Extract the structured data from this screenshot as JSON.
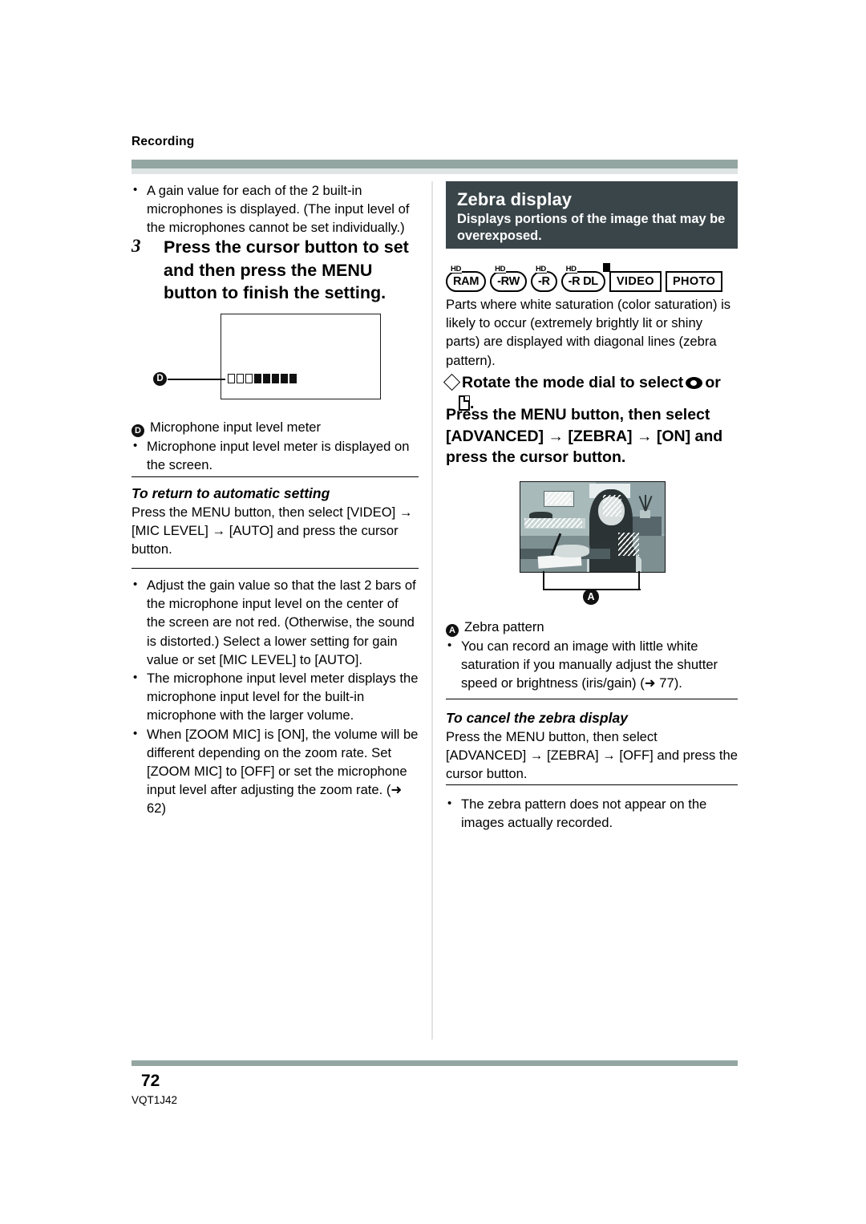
{
  "header": {
    "section": "Recording"
  },
  "footer": {
    "page_number": "72",
    "doc_code": "VQT1J42"
  },
  "left_column": {
    "intro_bullet": "A gain value for each of the 2 built-in microphones is displayed. (The input level of the microphones cannot be set individually.)",
    "step": {
      "number": "3",
      "text": "Press the cursor button to set and then press the MENU button to finish the setting."
    },
    "figure": {
      "callout_label": "D",
      "meter_cells": [
        "empty",
        "empty",
        "empty",
        "filled",
        "filled",
        "filled",
        "filled",
        "filled"
      ]
    },
    "callout_caption": "Microphone input level meter",
    "callout_bullet": "Microphone input level meter is displayed on the screen.",
    "return_auto": {
      "heading": "To return to automatic setting",
      "body": "Press the MENU button, then select [VIDEO] → [MIC LEVEL] → [AUTO] and press the cursor button."
    },
    "bullets": [
      "Adjust the gain value so that the last 2 bars of the microphone input level on the center of the screen are not red. (Otherwise, the sound is distorted.) Select a lower setting for gain value or set [MIC LEVEL] to [AUTO].",
      "The microphone input level meter displays the microphone input level for the built-in microphone with the larger volume.",
      "When [ZOOM MIC] is [ON], the volume will be different depending on the zoom rate. Set [ZOOM MIC] to [OFF] or set the microphone input level after adjusting the zoom rate. (➜ 62)"
    ]
  },
  "right_column": {
    "title_box": {
      "title": "Zebra display",
      "subtitle": "Displays portions of the image that may be overexposed."
    },
    "badges": [
      {
        "hd": "HD",
        "label": "RAM",
        "style": "disc"
      },
      {
        "hd": "HD",
        "label": "-RW",
        "style": "disc"
      },
      {
        "hd": "HD",
        "label": "-R",
        "style": "disc"
      },
      {
        "hd": "HD",
        "label": "-R DL",
        "style": "disc"
      },
      {
        "hd": "",
        "label": "VIDEO",
        "style": "tabbed"
      },
      {
        "hd": "",
        "label": "PHOTO",
        "style": "plain"
      }
    ],
    "intro_paragraph": "Parts where white saturation (color saturation) is likely to occur (extremely brightly lit or shiny parts) are displayed with diagonal lines (zebra pattern).",
    "instruction": {
      "rotate_prefix": "Rotate the mode dial to select",
      "rotate_middle": "or",
      "rotate_suffix": ".",
      "press_text": "Press the MENU button, then select [ADVANCED] → [ZEBRA] → [ON] and press the cursor button."
    },
    "illustration": {
      "callout_label": "A"
    },
    "callout_caption": "Zebra pattern",
    "callout_bullet": "You can record an image with little white saturation if you manually adjust the shutter speed or brightness (iris/gain) (➜ 77).",
    "cancel": {
      "heading": "To cancel the zebra display",
      "body": "Press the MENU button, then select [ADVANCED] → [ZEBRA] → [OFF] and press the cursor button."
    },
    "last_bullet": "The zebra pattern does not appear on the images actually recorded."
  },
  "colors": {
    "header_rule": "#94a6a2",
    "header_rule_light": "#dde4e3",
    "dark_box": "#3a4549",
    "text": "#000000"
  }
}
